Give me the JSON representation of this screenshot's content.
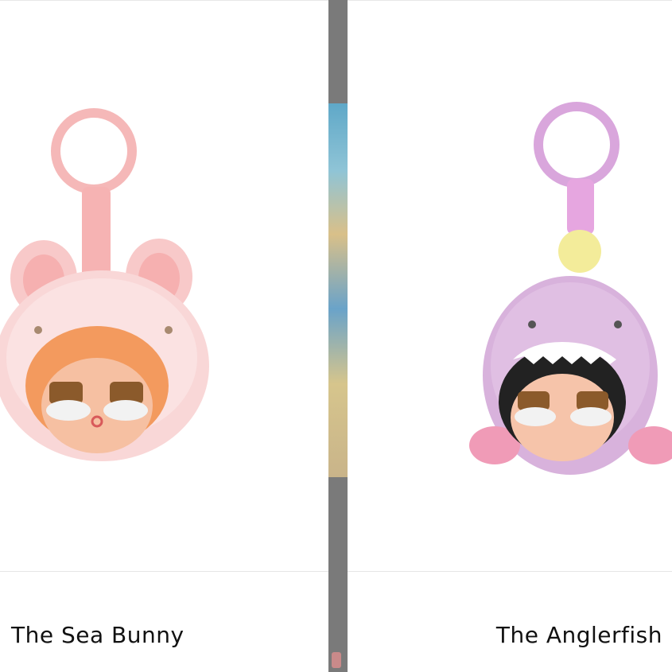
{
  "products": [
    {
      "name": "The Sea Bunny",
      "image_alt": "pink sea bunny plush keychain"
    },
    {
      "name": "The Anglerfish",
      "image_alt": "purple anglerfish plush keychain"
    }
  ],
  "colors": {
    "divider": "#7a7a7a",
    "bunny_pink": "#f7c6c6",
    "angler_purple": "#d8b2dc"
  }
}
